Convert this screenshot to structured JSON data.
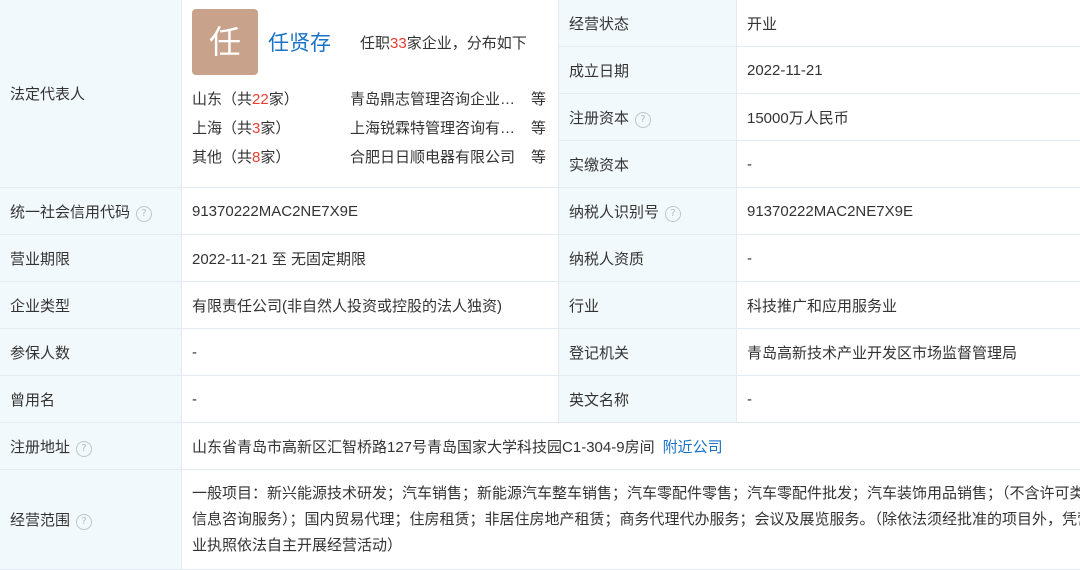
{
  "legal_rep": {
    "label": "法定代表人",
    "avatar_char": "任",
    "name": "任贤存",
    "summary_prefix": "任职",
    "summary_count": "33",
    "summary_suffix": "家企业，分布如下",
    "regions": [
      {
        "name": "山东",
        "count": "22",
        "company": "青岛鼎志管理咨询企业（有限合伙）",
        "more": "等"
      },
      {
        "name": "上海",
        "count": "3",
        "company": "上海锐霖特管理咨询有限公司",
        "more": "等"
      },
      {
        "name": "其他",
        "count": "8",
        "company": "合肥日日顺电器有限公司",
        "more": "等"
      }
    ]
  },
  "rows": {
    "status": {
      "label": "经营状态",
      "value": "开业"
    },
    "established": {
      "label": "成立日期",
      "value": "2022-11-21"
    },
    "reg_capital": {
      "label": "注册资本",
      "value": "15000万人民币"
    },
    "paid_capital": {
      "label": "实缴资本",
      "value": "-"
    },
    "credit_code": {
      "label": "统一社会信用代码",
      "value": "91370222MAC2NE7X9E"
    },
    "taxpayer_id": {
      "label": "纳税人识别号",
      "value": "91370222MAC2NE7X9E"
    },
    "term": {
      "label": "营业期限",
      "value": "2022-11-21 至 无固定期限"
    },
    "taxpayer_qual": {
      "label": "纳税人资质",
      "value": "-"
    },
    "company_type": {
      "label": "企业类型",
      "value": "有限责任公司(非自然人投资或控股的法人独资)"
    },
    "industry": {
      "label": "行业",
      "value": "科技推广和应用服务业"
    },
    "insured": {
      "label": "参保人数",
      "value": "-"
    },
    "authority": {
      "label": "登记机关",
      "value": "青岛高新技术产业开发区市场监督管理局"
    },
    "former_name": {
      "label": "曾用名",
      "value": "-"
    },
    "english_name": {
      "label": "英文名称",
      "value": "-"
    },
    "address": {
      "label": "注册地址",
      "value": "山东省青岛市高新区汇智桥路127号青岛国家大学科技园C1-304-9房间",
      "link": "附近公司"
    },
    "scope": {
      "label": "经营范围",
      "value": "一般项目：新兴能源技术研发；汽车销售；新能源汽车整车销售；汽车零配件零售；汽车零配件批发；汽车装饰用品销售；（不含许可类信息咨询服务）；国内贸易代理；住房租赁；非居住房地产租赁；商务代理代办服务；会议及展览服务。（除依法须经批准的项目外，凭营业执照依法自主开展经营活动）"
    }
  },
  "icons": {
    "help": "question-circle-icon"
  }
}
